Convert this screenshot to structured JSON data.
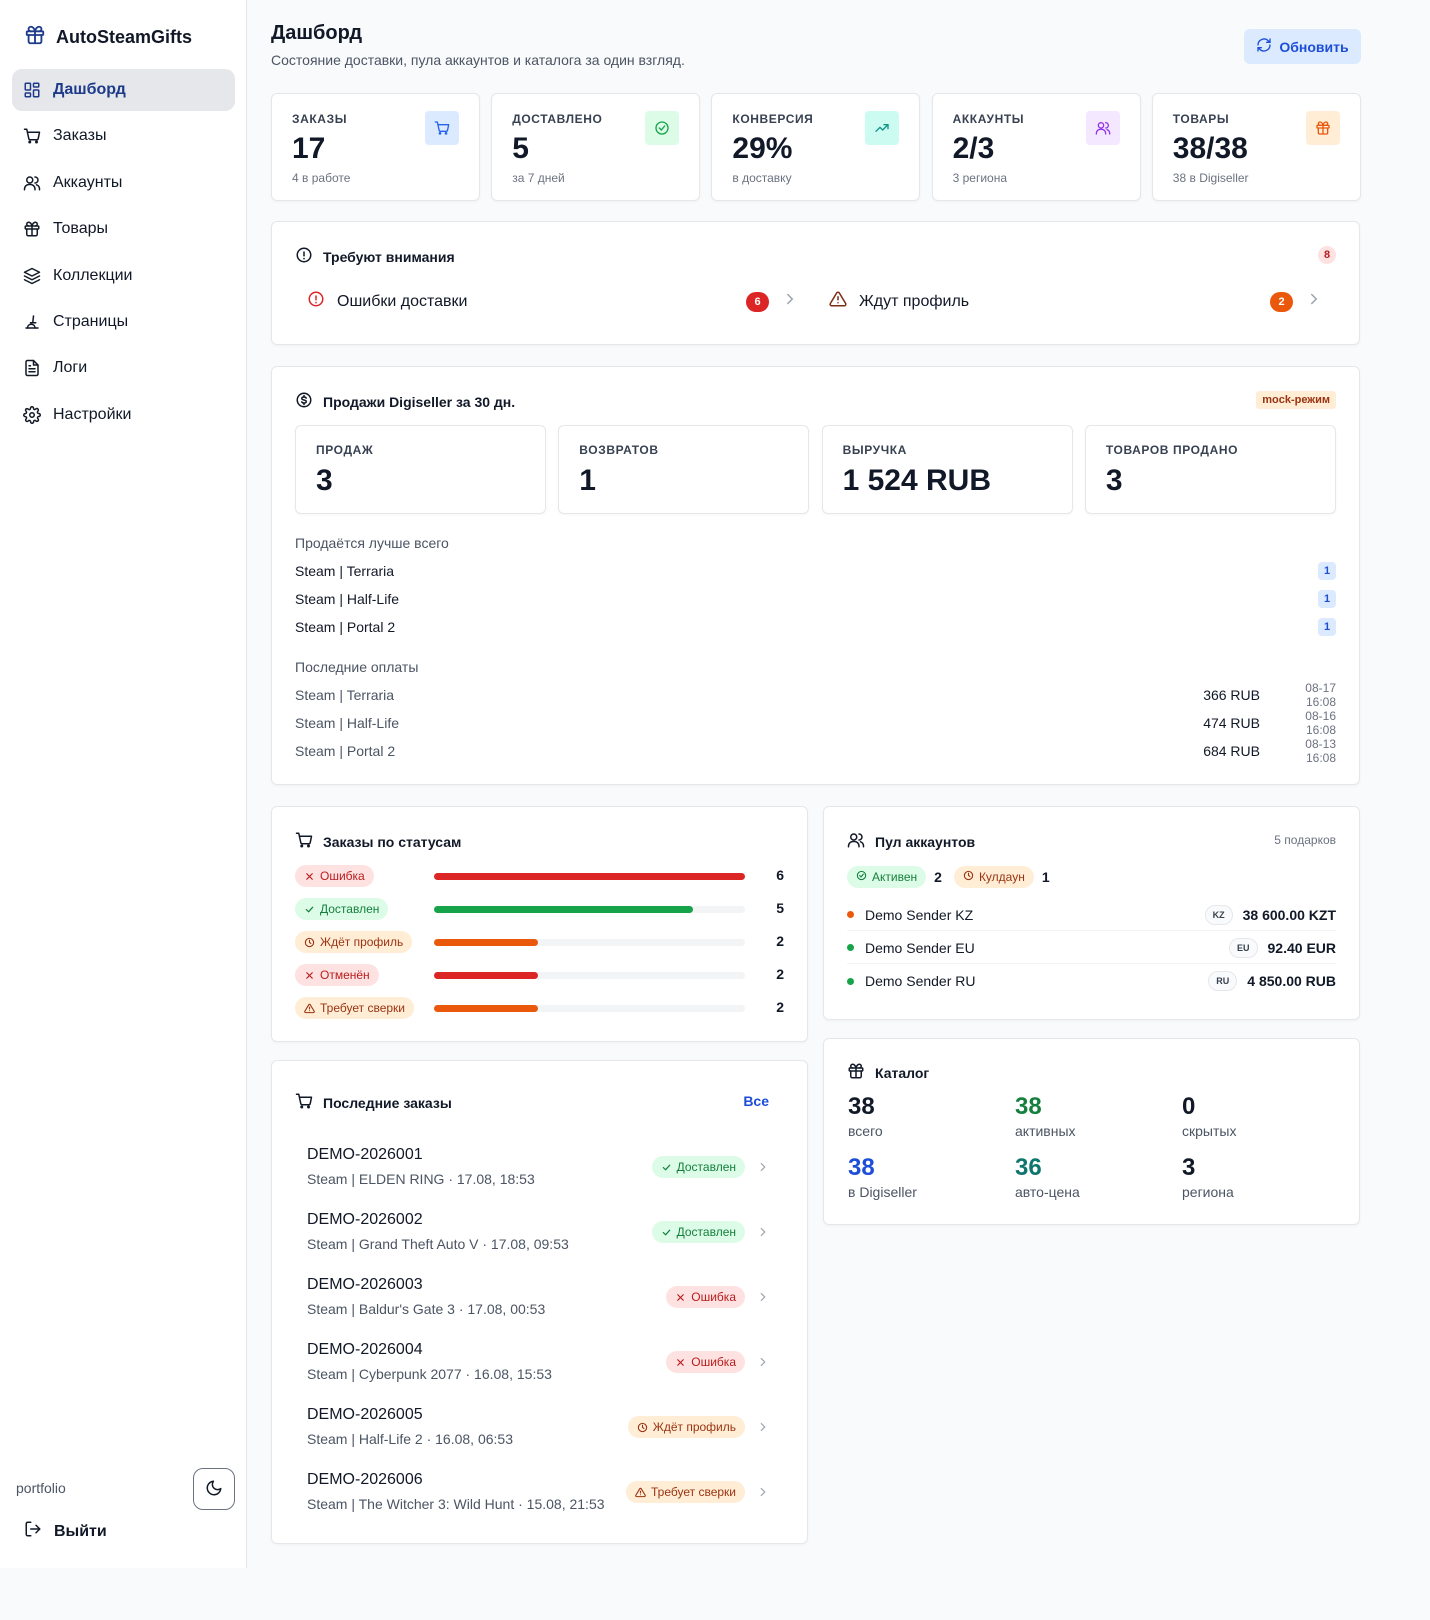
{
  "brand": {
    "name": "AutoSteamGifts"
  },
  "nav": {
    "items": [
      {
        "label": "Дашборд",
        "icon": "dashboard-icon",
        "active": true
      },
      {
        "label": "Заказы",
        "icon": "cart-icon"
      },
      {
        "label": "Аккаунты",
        "icon": "users-icon"
      },
      {
        "label": "Товары",
        "icon": "gift-icon"
      },
      {
        "label": "Коллекции",
        "icon": "layers-icon"
      },
      {
        "label": "Страницы",
        "icon": "brush-icon"
      },
      {
        "label": "Логи",
        "icon": "file-icon"
      },
      {
        "label": "Настройки",
        "icon": "gear-icon"
      }
    ],
    "footer_label": "portfolio",
    "logout_label": "Выйти"
  },
  "header": {
    "title": "Дашборд",
    "subtitle": "Состояние доставки, пула аккаунтов и каталога за один взгляд.",
    "refresh_label": "Обновить"
  },
  "stats": [
    {
      "label": "ЗАКАЗЫ",
      "value": "17",
      "hint": "4 в работе",
      "icon": "cart-icon",
      "color": "#2563eb",
      "bg": "#dbeafe"
    },
    {
      "label": "ДОСТАВЛЕНО",
      "value": "5",
      "hint": "за 7 дней",
      "icon": "check-circle-icon",
      "color": "#16a34a",
      "bg": "#dcfce7"
    },
    {
      "label": "КОНВЕРСИЯ",
      "value": "29%",
      "hint": "в доставку",
      "icon": "trend-up-icon",
      "color": "#0d9488",
      "bg": "#ccfbf1"
    },
    {
      "label": "АККАУНТЫ",
      "value": "2/3",
      "hint": "3 региона",
      "icon": "users-icon",
      "color": "#9333ea",
      "bg": "#f3e8ff"
    },
    {
      "label": "ТОВАРЫ",
      "value": "38/38",
      "hint": "38 в Digiseller",
      "icon": "gift-icon",
      "color": "#ea580c",
      "bg": "#ffedd5"
    }
  ],
  "attention": {
    "title": "Требуют внимания",
    "total": "8",
    "items": [
      {
        "label": "Ошибки доставки",
        "count": "6",
        "color": "#dc2626"
      },
      {
        "label": "Ждут профиль",
        "count": "2",
        "color": "#ea580c"
      }
    ]
  },
  "sales": {
    "title": "Продажи Digiseller за 30 дн.",
    "mode_badge": "mock-режим",
    "stats": [
      {
        "label": "ПРОДАЖ",
        "value": "3"
      },
      {
        "label": "ВОЗВРАТОВ",
        "value": "1"
      },
      {
        "label": "ВЫРУЧКА",
        "value": "1 524 RUB"
      },
      {
        "label": "ТОВАРОВ ПРОДАНО",
        "value": "3"
      }
    ],
    "best_title": "Продаётся лучше всего",
    "best": [
      {
        "name": "Steam | Terraria",
        "count": "1"
      },
      {
        "name": "Steam | Half-Life",
        "count": "1"
      },
      {
        "name": "Steam | Portal 2",
        "count": "1"
      }
    ],
    "payments_title": "Последние оплаты",
    "payments": [
      {
        "name": "Steam | Terraria",
        "amount": "366 RUB",
        "time": "08-17 16:08"
      },
      {
        "name": "Steam | Half-Life",
        "amount": "474 RUB",
        "time": "08-16 16:08"
      },
      {
        "name": "Steam | Portal 2",
        "amount": "684 RUB",
        "time": "08-13 16:08"
      }
    ]
  },
  "statuses": {
    "title": "Заказы по статусам",
    "max": 6,
    "items": [
      {
        "label": "Ошибка",
        "count": 6,
        "icon": "x-icon",
        "kind": "red"
      },
      {
        "label": "Доставлен",
        "count": 5,
        "icon": "check-icon",
        "kind": "green"
      },
      {
        "label": "Ждёт профиль",
        "count": 2,
        "icon": "clock-icon",
        "kind": "orange"
      },
      {
        "label": "Отменён",
        "count": 2,
        "icon": "x-icon",
        "kind": "red"
      },
      {
        "label": "Требует сверки",
        "count": 2,
        "icon": "warning-icon",
        "kind": "orange"
      }
    ]
  },
  "recent": {
    "title": "Последние заказы",
    "all_link": "Все",
    "orders": [
      {
        "id": "DEMO-2026001",
        "sub": "Steam | ELDEN RING · 17.08, 18:53",
        "status": "Доставлен",
        "kind": "green",
        "icon": "check-icon"
      },
      {
        "id": "DEMO-2026002",
        "sub": "Steam | Grand Theft Auto V · 17.08, 09:53",
        "status": "Доставлен",
        "kind": "green",
        "icon": "check-icon"
      },
      {
        "id": "DEMO-2026003",
        "sub": "Steam | Baldur's Gate 3 · 17.08, 00:53",
        "status": "Ошибка",
        "kind": "red",
        "icon": "x-icon"
      },
      {
        "id": "DEMO-2026004",
        "sub": "Steam | Cyberpunk 2077 · 16.08, 15:53",
        "status": "Ошибка",
        "kind": "red",
        "icon": "x-icon"
      },
      {
        "id": "DEMO-2026005",
        "sub": "Steam | Half-Life 2 · 16.08, 06:53",
        "status": "Ждёт профиль",
        "kind": "orange",
        "icon": "clock-icon"
      },
      {
        "id": "DEMO-2026006",
        "sub": "Steam | The Witcher 3: Wild Hunt · 15.08, 21:53",
        "status": "Требует сверки",
        "kind": "orange",
        "icon": "warning-icon"
      }
    ]
  },
  "pool": {
    "title": "Пул аккаунтов",
    "gifts": "5 подарков",
    "active_label": "Активен",
    "active_count": "2",
    "cooldown_label": "Кулдаун",
    "cooldown_count": "1",
    "accounts": [
      {
        "name": "Demo Sender KZ",
        "region": "KZ",
        "balance": "38 600.00 KZT",
        "dot": "#ea580c"
      },
      {
        "name": "Demo Sender EU",
        "region": "EU",
        "balance": "92.40 EUR",
        "dot": "#16a34a"
      },
      {
        "name": "Demo Sender RU",
        "region": "RU",
        "balance": "4 850.00 RUB",
        "dot": "#16a34a"
      }
    ]
  },
  "catalog": {
    "title": "Каталог",
    "cells": [
      {
        "value": "38",
        "label": "всего",
        "color": "#111827"
      },
      {
        "value": "38",
        "label": "активных",
        "color": "#15803d"
      },
      {
        "value": "0",
        "label": "скрытых",
        "color": "#111827"
      },
      {
        "value": "38",
        "label": "в Digiseller",
        "color": "#1d4ed8"
      },
      {
        "value": "36",
        "label": "авто-цена",
        "color": "#0f766e"
      },
      {
        "value": "3",
        "label": "региона",
        "color": "#111827"
      }
    ]
  },
  "colors": {
    "accent": "#1d4ed8",
    "red": "#dc2626",
    "green": "#16a34a",
    "orange": "#ea580c"
  }
}
